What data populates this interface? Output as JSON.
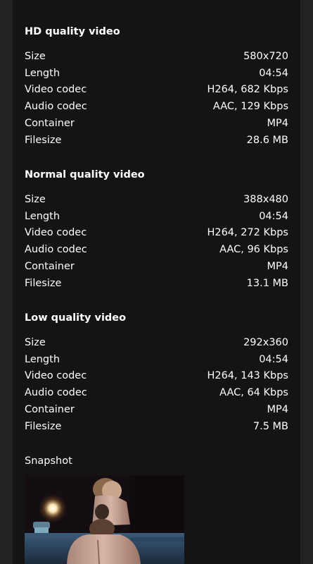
{
  "sections": [
    {
      "title": "HD quality video",
      "rows": [
        {
          "key": "Size",
          "value": "580x720"
        },
        {
          "key": "Length",
          "value": "04:54"
        },
        {
          "key": "Video codec",
          "value": "H264, 682 Kbps"
        },
        {
          "key": "Audio codec",
          "value": "AAC, 129 Kbps"
        },
        {
          "key": "Container",
          "value": "MP4"
        },
        {
          "key": "Filesize",
          "value": "28.6 MB"
        }
      ]
    },
    {
      "title": "Normal quality video",
      "rows": [
        {
          "key": "Size",
          "value": "388x480"
        },
        {
          "key": "Length",
          "value": "04:54"
        },
        {
          "key": "Video codec",
          "value": "H264, 272 Kbps"
        },
        {
          "key": "Audio codec",
          "value": "AAC, 96 Kbps"
        },
        {
          "key": "Container",
          "value": "MP4"
        },
        {
          "key": "Filesize",
          "value": "13.1 MB"
        }
      ]
    },
    {
      "title": "Low quality video",
      "rows": [
        {
          "key": "Size",
          "value": "292x360"
        },
        {
          "key": "Length",
          "value": "04:54"
        },
        {
          "key": "Video codec",
          "value": "H264, 143 Kbps"
        },
        {
          "key": "Audio codec",
          "value": "AAC, 64 Kbps"
        },
        {
          "key": "Container",
          "value": "MP4"
        },
        {
          "key": "Filesize",
          "value": "7.5 MB"
        }
      ]
    }
  ],
  "snapshot": {
    "label": "Snapshot"
  },
  "colors": {
    "page_bg": "#222222",
    "panel_bg": "#141414",
    "text": "#ffffff"
  }
}
